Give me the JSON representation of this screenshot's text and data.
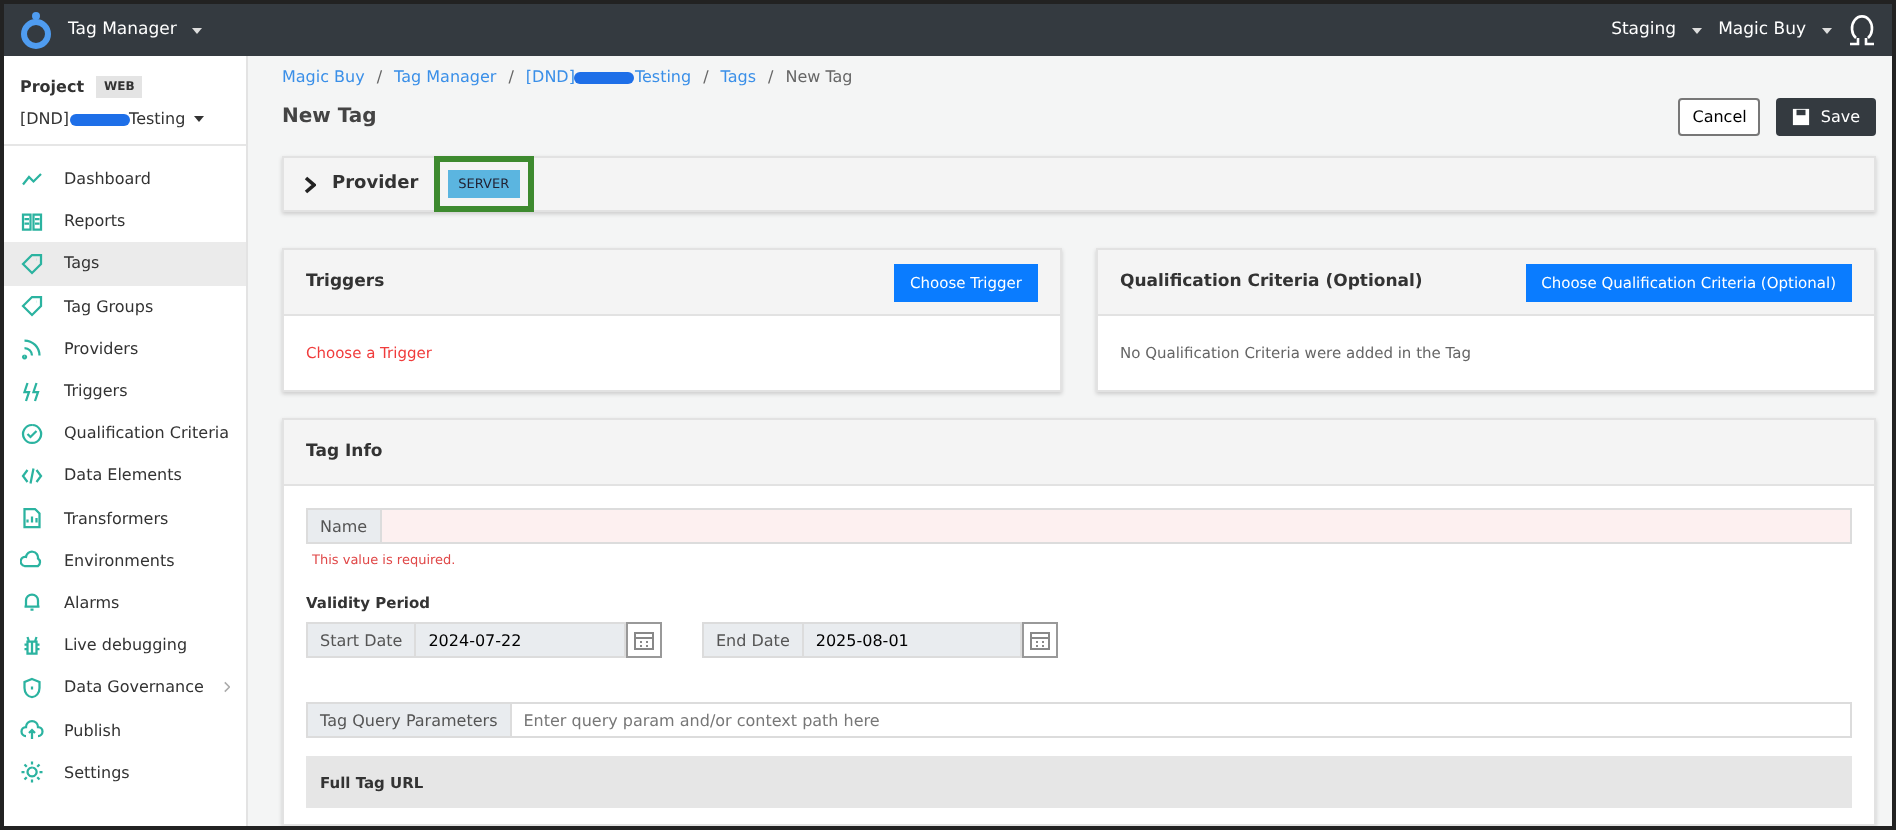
{
  "topbar": {
    "app_name": "Tag Manager",
    "menus": [
      "Staging",
      "Magic Buy"
    ]
  },
  "sidebar": {
    "project_label": "Project",
    "project_badge": "WEB",
    "project_name_start": "[DND]",
    "project_name_end": "Testing",
    "items": [
      {
        "label": "Dashboard",
        "selected": false,
        "has_children": false
      },
      {
        "label": "Reports",
        "selected": false,
        "has_children": false
      },
      {
        "label": "Tags",
        "selected": true,
        "has_children": false
      },
      {
        "label": "Tag Groups",
        "selected": false,
        "has_children": false
      },
      {
        "label": "Providers",
        "selected": false,
        "has_children": false
      },
      {
        "label": "Triggers",
        "selected": false,
        "has_children": false
      },
      {
        "label": "Qualification Criteria",
        "selected": false,
        "has_children": false
      },
      {
        "label": "Data Elements",
        "selected": false,
        "has_children": false
      },
      {
        "label": "Transformers",
        "selected": false,
        "has_children": false
      },
      {
        "label": "Environments",
        "selected": false,
        "has_children": false
      },
      {
        "label": "Alarms",
        "selected": false,
        "has_children": false
      },
      {
        "label": "Live debugging",
        "selected": false,
        "has_children": false
      },
      {
        "label": "Data Governance",
        "selected": false,
        "has_children": true
      },
      {
        "label": "Publish",
        "selected": false,
        "has_children": false
      },
      {
        "label": "Settings",
        "selected": false,
        "has_children": false
      }
    ]
  },
  "breadcrumb": [
    {
      "label": "Magic Buy"
    },
    {
      "sep": "/",
      "label": "Tag Manager"
    },
    {
      "sep": "/",
      "label": "[DND]",
      "label_end": "Testing"
    },
    {
      "sep": "/",
      "label": "Tags"
    },
    {
      "sep": "/",
      "label": "New Tag"
    }
  ],
  "page_title": "New Tag",
  "actions": {
    "cancel": "Cancel",
    "save": "Save"
  },
  "provider": {
    "label": "Provider",
    "badge": "SERVER",
    "expanded": false,
    "highlighted": true
  },
  "triggers": {
    "title": "Triggers",
    "button": "Choose Trigger",
    "message": "Choose a Trigger"
  },
  "qualification": {
    "title": "Qualification Criteria (Optional)",
    "button": "Choose Qualification Criteria (Optional)",
    "message": "No Qualification Criteria were added in the Tag"
  },
  "tag_info": {
    "title": "Tag Info",
    "name_field": {
      "label": "Name",
      "invalid": true,
      "error": "This value is required."
    },
    "validity_label": "Validity Period",
    "start_date": {
      "label": "Start Date",
      "value": "2024-07-22"
    },
    "end_date": {
      "label": "End Date",
      "value": "2025-08-01"
    },
    "query_field": {
      "label": "Tag Query Parameters",
      "placeholder": "Enter query param and/or context path here"
    },
    "full_url_title": "Full Tag URL"
  }
}
